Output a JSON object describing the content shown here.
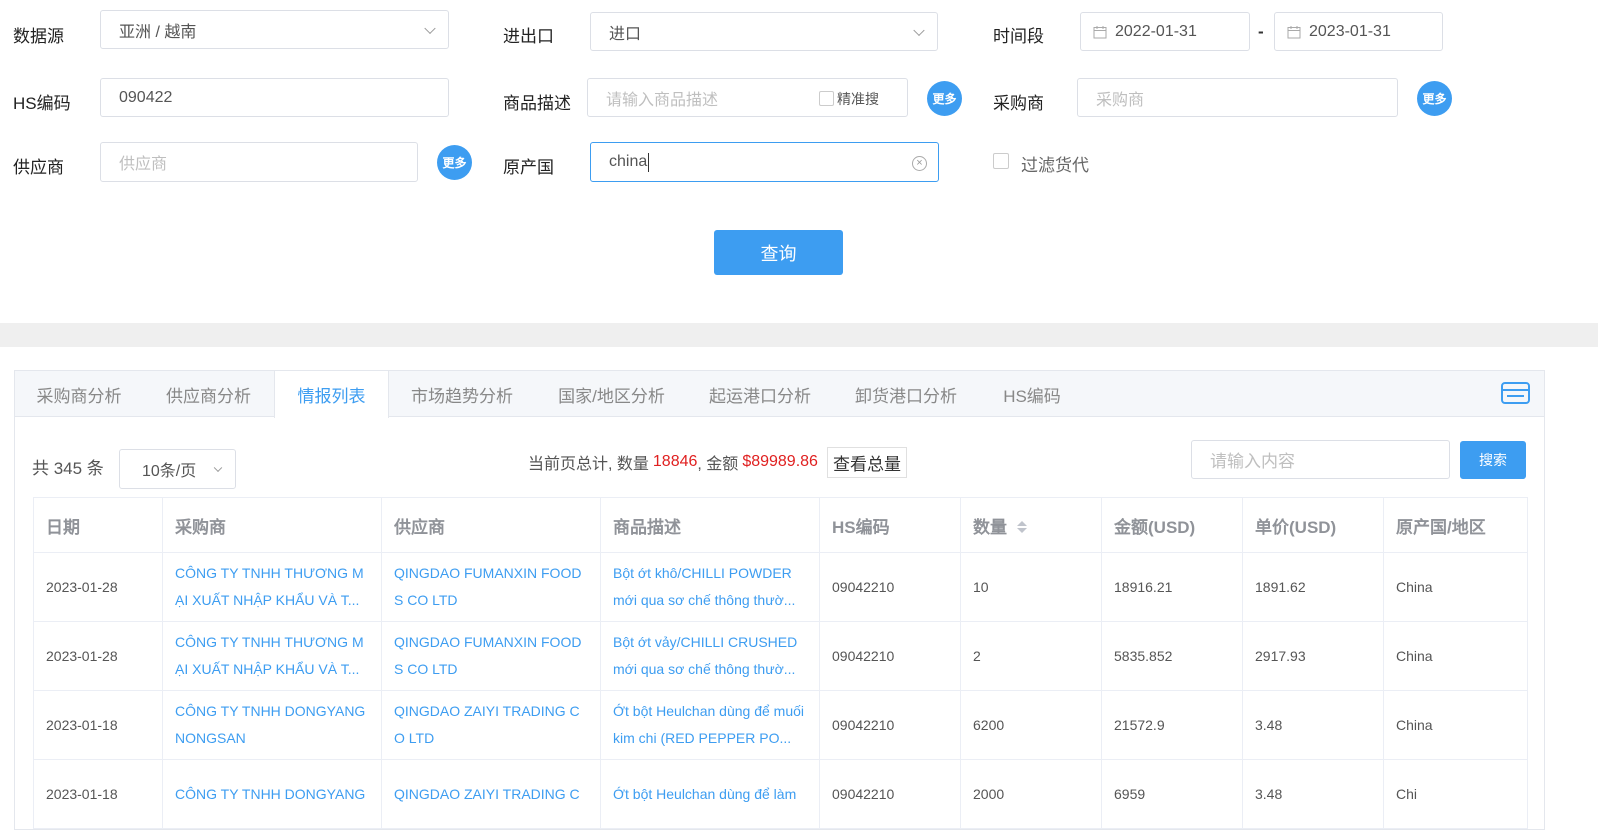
{
  "form": {
    "datasource": {
      "label": "数据源",
      "value": "亚洲 / 越南"
    },
    "import_export": {
      "label": "进出口",
      "value": "进口"
    },
    "period": {
      "label": "时间段",
      "start": "2022-01-31",
      "separator": "-",
      "end": "2023-01-31"
    },
    "hs_code": {
      "label": "HS编码",
      "value": "090422"
    },
    "goods_desc": {
      "label": "商品描述",
      "placeholder": "请输入商品描述",
      "exact_label": "精准搜"
    },
    "buyer": {
      "label": "采购商",
      "placeholder": "采购商"
    },
    "supplier": {
      "label": "供应商",
      "placeholder": "供应商"
    },
    "origin": {
      "label": "原产国",
      "value": "china"
    },
    "filter_forwarder": {
      "label": "过滤货代"
    },
    "more_label": "更多",
    "query_label": "查询"
  },
  "tabs": [
    "采购商分析",
    "供应商分析",
    "情报列表",
    "市场趋势分析",
    "国家/地区分析",
    "起运港口分析",
    "卸货港口分析",
    "HS编码"
  ],
  "active_tab": "情报列表",
  "summary": {
    "total": "共 345 条",
    "page_size": "10条/页",
    "page_total_prefix": "当前页总计, 数量",
    "qty": "18846",
    "amount_prefix": ", 金额",
    "amount": "$89989.86",
    "view_total": "查看总量",
    "search_placeholder": "请输入内容",
    "search_label": "搜索"
  },
  "table": {
    "columns": [
      "日期",
      "采购商",
      "供应商",
      "商品描述",
      "HS编码",
      "数量",
      "金额(USD)",
      "单价(USD)",
      "原产国/地区"
    ],
    "rows": [
      [
        "2023-01-28",
        "CÔNG TY TNHH THƯƠNG MẠI XUẤT NHẬP KHẨU VÀ T...",
        "QINGDAO FUMANXIN FOODS CO LTD",
        "Bột ớt khô/CHILLI POWDER mới qua sơ chế thông thườ...",
        "09042210",
        "10",
        "18916.21",
        "1891.62",
        "China"
      ],
      [
        "2023-01-28",
        "CÔNG TY TNHH THƯƠNG MẠI XUẤT NHẬP KHẨU VÀ T...",
        "QINGDAO FUMANXIN FOODS CO LTD",
        "Bột ớt vảy/CHILLI CRUSHED mới qua sơ chế thông thườ...",
        "09042210",
        "2",
        "5835.852",
        "2917.93",
        "China"
      ],
      [
        "2023-01-18",
        "CÔNG TY TNHH DONGYANG NONGSAN",
        "QINGDAO ZAIYI TRADING CO LTD",
        "Ớt bột Heulchan dùng để muối kim chi (RED PEPPER PO...",
        "09042210",
        "6200",
        "21572.9",
        "3.48",
        "China"
      ],
      [
        "2023-01-18",
        "CÔNG TY TNHH DONGYANG",
        "QINGDAO ZAIYI TRADING C",
        "Ớt bột Heulchan dùng để làm",
        "09042210",
        "2000",
        "6959",
        "3.48",
        "Chi"
      ]
    ]
  }
}
